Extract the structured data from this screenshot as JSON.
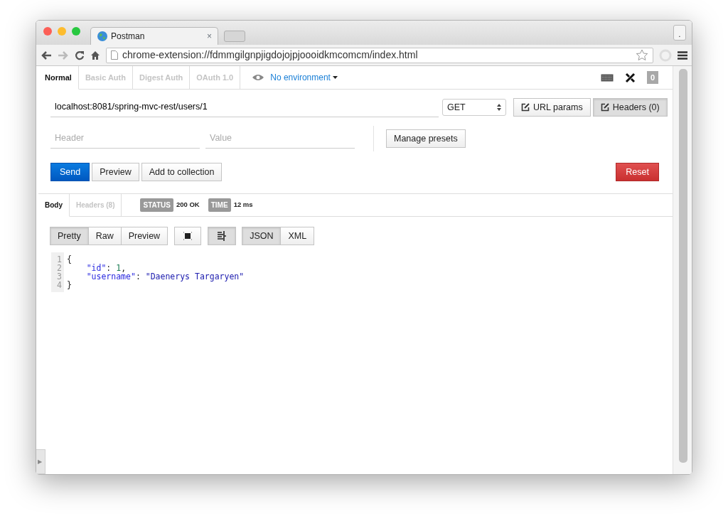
{
  "browser": {
    "tab_title": "Postman",
    "tab_close": "×",
    "profile_button": ".",
    "address": "chrome-extension://fdmmgilgnpjigdojojpjoooidkmcomcm/index.html"
  },
  "auth_tabs": [
    {
      "label": "Normal",
      "selected": true
    },
    {
      "label": "Basic Auth",
      "selected": false
    },
    {
      "label": "Digest Auth",
      "selected": false
    },
    {
      "label": "OAuth 1.0",
      "selected": false
    }
  ],
  "environment": "No environment",
  "history_count": "0",
  "request": {
    "url": "localhost:8081/spring-mvc-rest/users/1",
    "method": "GET",
    "param_buttons": [
      {
        "label": "URL params",
        "selected": false
      },
      {
        "label": "Headers (0)",
        "selected": true
      }
    ],
    "header_placeholder": "Header",
    "value_placeholder": "Value",
    "manage_presets": "Manage presets",
    "actions": [
      {
        "label": "Send",
        "kind": "primary"
      },
      {
        "label": "Preview",
        "kind": "default"
      },
      {
        "label": "Add to collection",
        "kind": "default"
      },
      {
        "label": "Reset",
        "kind": "danger"
      }
    ]
  },
  "response_tabs": [
    {
      "label": "Body",
      "selected": true
    },
    {
      "label": "Headers (8)",
      "selected": false
    }
  ],
  "status": {
    "status_label": "STATUS",
    "status_value": "200 OK",
    "time_label": "TIME",
    "time_value": "12 ms"
  },
  "view_modes": [
    {
      "label": "Pretty",
      "selected": true
    },
    {
      "label": "Raw",
      "selected": false
    },
    {
      "label": "Preview",
      "selected": false
    }
  ],
  "formats": [
    {
      "label": "JSON",
      "selected": true
    },
    {
      "label": "XML",
      "selected": false
    }
  ],
  "code_lines": [
    {
      "number": "1",
      "indented": false,
      "tokens": [
        {
          "kind": "punct",
          "text": "{"
        }
      ]
    },
    {
      "number": "2",
      "indented": true,
      "tokens": [
        {
          "kind": "key",
          "text": "\"id\""
        },
        {
          "kind": "punct",
          "text": ": "
        },
        {
          "kind": "number",
          "text": "1"
        },
        {
          "kind": "punct",
          "text": ","
        }
      ]
    },
    {
      "number": "3",
      "indented": true,
      "tokens": [
        {
          "kind": "key",
          "text": "\"username\""
        },
        {
          "kind": "punct",
          "text": ": "
        },
        {
          "kind": "string",
          "text": "\"Daenerys Targaryen\""
        }
      ]
    },
    {
      "number": "4",
      "indented": false,
      "tokens": [
        {
          "kind": "punct",
          "text": "}"
        }
      ]
    }
  ],
  "sidebar_toggle": "▶"
}
